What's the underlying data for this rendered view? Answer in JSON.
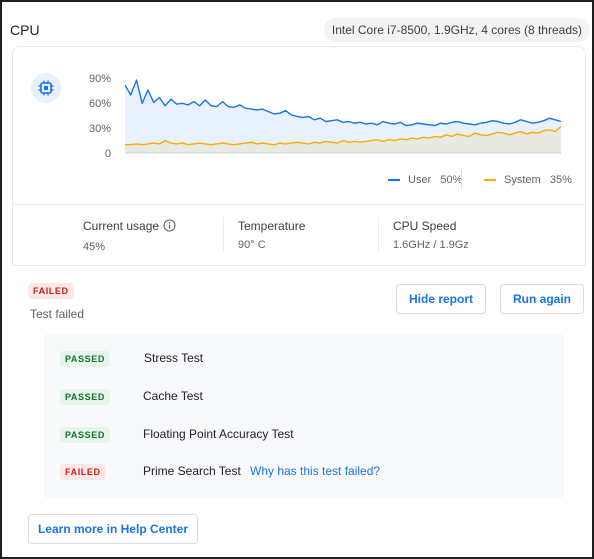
{
  "header": {
    "title": "CPU",
    "processor": "Intel Core i7-8500, 1.9GHz, 4 cores (8 threads)"
  },
  "chart_data": {
    "type": "area",
    "y_ticks": [
      "90%",
      "60%",
      "30%",
      "0"
    ],
    "ylim": [
      0,
      100
    ],
    "grid": false,
    "series": [
      {
        "name": "User",
        "color": "#1a73e8",
        "values": [
          82,
          70,
          88,
          60,
          76,
          61,
          67,
          57,
          65,
          59,
          60,
          58,
          62,
          57,
          64,
          57,
          56,
          62,
          56,
          55,
          58,
          54,
          53,
          52,
          53,
          50,
          47,
          48,
          51,
          46,
          44,
          43,
          44,
          40,
          42,
          38,
          39,
          40,
          37,
          38,
          36,
          37,
          35,
          36,
          34,
          38,
          36,
          35,
          37,
          33,
          34,
          36,
          35,
          34,
          33,
          36,
          35,
          37,
          38,
          36,
          35,
          34,
          36,
          37,
          39,
          38,
          36,
          35,
          37,
          40,
          38,
          36,
          37,
          39,
          42,
          40,
          38
        ]
      },
      {
        "name": "System",
        "color": "#f9ab00",
        "values": [
          10,
          10,
          11,
          10,
          11,
          12,
          11,
          15,
          12,
          11,
          12,
          10,
          11,
          12,
          11,
          10,
          11,
          12,
          11,
          10,
          11,
          12,
          13,
          11,
          12,
          11,
          10,
          12,
          11,
          12,
          13,
          12,
          11,
          13,
          12,
          14,
          13,
          12,
          15,
          13,
          14,
          13,
          14,
          15,
          16,
          14,
          16,
          15,
          17,
          16,
          18,
          17,
          19,
          18,
          20,
          19,
          22,
          20,
          23,
          21,
          20,
          24,
          22,
          21,
          23,
          25,
          24,
          22,
          24,
          26,
          23,
          25,
          24,
          27,
          28,
          26,
          32
        ]
      }
    ]
  },
  "legend": {
    "user_label": "User",
    "user_value": "50%",
    "system_label": "System",
    "system_value": "35%"
  },
  "stats": {
    "current_usage_label": "Current usage",
    "current_usage_value": "45%",
    "temperature_label": "Temperature",
    "temperature_value": "90° C",
    "cpu_speed_label": "CPU Speed",
    "cpu_speed_value": "1.6GHz / 1.9Gz"
  },
  "result": {
    "badge": "FAILED",
    "text": "Test failed",
    "hide_report": "Hide report",
    "run_again": "Run again"
  },
  "tests": [
    {
      "status": "PASSED",
      "name": "Stress Test"
    },
    {
      "status": "PASSED",
      "name": "Cache Test"
    },
    {
      "status": "PASSED",
      "name": "Floating Point Accuracy Test"
    },
    {
      "status": "FAILED",
      "name": "Prime Search Test",
      "link": "Why has this test failed?"
    }
  ],
  "footer": {
    "help_button": "Learn more in Help Center"
  }
}
